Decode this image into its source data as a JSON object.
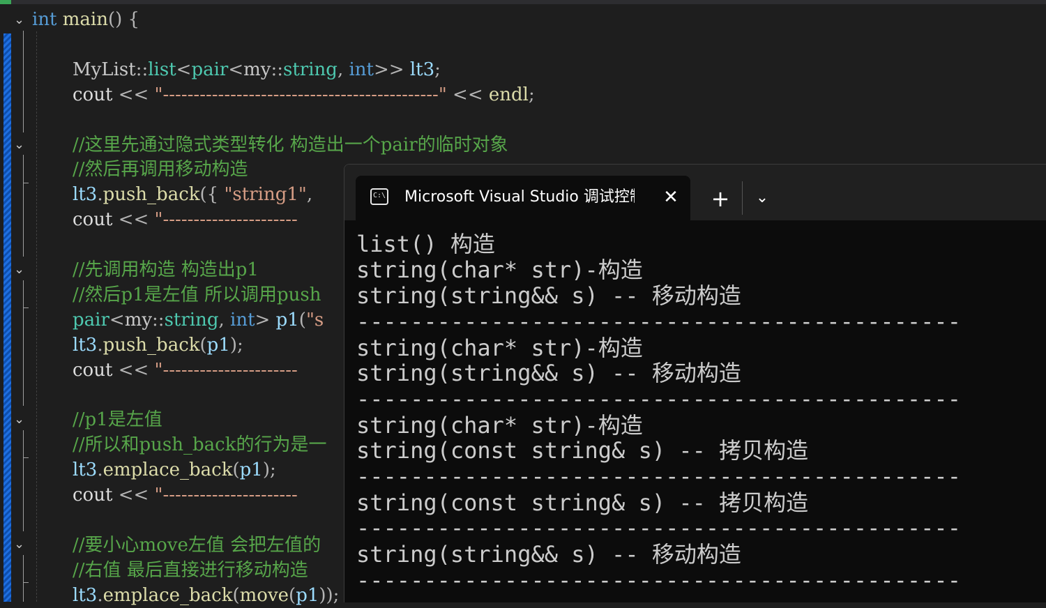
{
  "editor": {
    "lines": [
      [
        [
          "kw",
          "int"
        ],
        [
          "pl",
          " "
        ],
        [
          "fn",
          "main"
        ],
        [
          "op",
          "() {"
        ]
      ],
      [],
      [
        [
          "ns",
          "MyList"
        ],
        [
          "op",
          "::"
        ],
        [
          "ty",
          "list"
        ],
        [
          "op",
          "<"
        ],
        [
          "ty",
          "pair"
        ],
        [
          "op",
          "<"
        ],
        [
          "ns",
          "my"
        ],
        [
          "op",
          "::"
        ],
        [
          "ty",
          "string"
        ],
        [
          "op",
          ", "
        ],
        [
          "kw",
          "int"
        ],
        [
          "op",
          ">> "
        ],
        [
          "var",
          "lt3"
        ],
        [
          "op",
          ";"
        ]
      ],
      [
        [
          "pl",
          "cout "
        ],
        [
          "op",
          "<< "
        ],
        [
          "str",
          "\"---------------------------------------------\""
        ],
        [
          "op",
          " << "
        ],
        [
          "fn",
          "endl"
        ],
        [
          "op",
          ";"
        ]
      ],
      [],
      [
        [
          "cm",
          "//这里先通过隐式类型转化 构造出一个pair的临时对象"
        ]
      ],
      [
        [
          "cm",
          "//然后再调用移动构造"
        ]
      ],
      [
        [
          "var",
          "lt3"
        ],
        [
          "op",
          "."
        ],
        [
          "fn",
          "push_back"
        ],
        [
          "op",
          "({ "
        ],
        [
          "str",
          "\"string1\""
        ],
        [
          "op",
          ","
        ]
      ],
      [
        [
          "pl",
          "cout "
        ],
        [
          "op",
          "<< "
        ],
        [
          "str",
          "\"----------------------"
        ]
      ],
      [],
      [
        [
          "cm",
          "//先调用构造 构造出p1"
        ]
      ],
      [
        [
          "cm",
          "//然后p1是左值 所以调用push"
        ]
      ],
      [
        [
          "ty",
          "pair"
        ],
        [
          "op",
          "<"
        ],
        [
          "ns",
          "my"
        ],
        [
          "op",
          "::"
        ],
        [
          "ty",
          "string"
        ],
        [
          "op",
          ", "
        ],
        [
          "kw",
          "int"
        ],
        [
          "op",
          "> "
        ],
        [
          "var",
          "p1"
        ],
        [
          "op",
          "("
        ],
        [
          "str",
          "\"s"
        ]
      ],
      [
        [
          "var",
          "lt3"
        ],
        [
          "op",
          "."
        ],
        [
          "fn",
          "push_back"
        ],
        [
          "op",
          "("
        ],
        [
          "var",
          "p1"
        ],
        [
          "op",
          ");"
        ]
      ],
      [
        [
          "pl",
          "cout "
        ],
        [
          "op",
          "<< "
        ],
        [
          "str",
          "\"----------------------"
        ]
      ],
      [],
      [
        [
          "cm",
          "//p1是左值"
        ]
      ],
      [
        [
          "cm",
          "//所以和push_back的行为是一"
        ]
      ],
      [
        [
          "var",
          "lt3"
        ],
        [
          "op",
          "."
        ],
        [
          "fn",
          "emplace_back"
        ],
        [
          "op",
          "("
        ],
        [
          "var",
          "p1"
        ],
        [
          "op",
          ");"
        ]
      ],
      [
        [
          "pl",
          "cout "
        ],
        [
          "op",
          "<< "
        ],
        [
          "str",
          "\"----------------------"
        ]
      ],
      [],
      [
        [
          "cm",
          "//要小心move左值 会把左值的"
        ]
      ],
      [
        [
          "cm",
          "//右值 最后直接进行移动构造"
        ]
      ],
      [
        [
          "var",
          "lt3"
        ],
        [
          "op",
          "."
        ],
        [
          "fn",
          "emplace_back"
        ],
        [
          "op",
          "("
        ],
        [
          "fn",
          "move"
        ],
        [
          "op",
          "("
        ],
        [
          "var",
          "p1"
        ],
        [
          "op",
          "));"
        ]
      ]
    ]
  },
  "terminal": {
    "tab_title": "Microsoft Visual Studio 调试控制台",
    "tab_icon_text": "C:\\",
    "close_glyph": "✕",
    "new_tab_glyph": "+",
    "dropdown_glyph": "⌄",
    "output": [
      "list() 构造",
      "string(char* str)-构造",
      "string(string&& s) -- 移动构造",
      "---------------------------------------------",
      "string(char* str)-构造",
      "string(string&& s) -- 移动构造",
      "---------------------------------------------",
      "string(char* str)-构造",
      "string(const string& s) -- 拷贝构造",
      "---------------------------------------------",
      "string(const string& s) -- 拷贝构造",
      "---------------------------------------------",
      "string(string&& s) -- 移动构造",
      "---------------------------------------------"
    ]
  }
}
